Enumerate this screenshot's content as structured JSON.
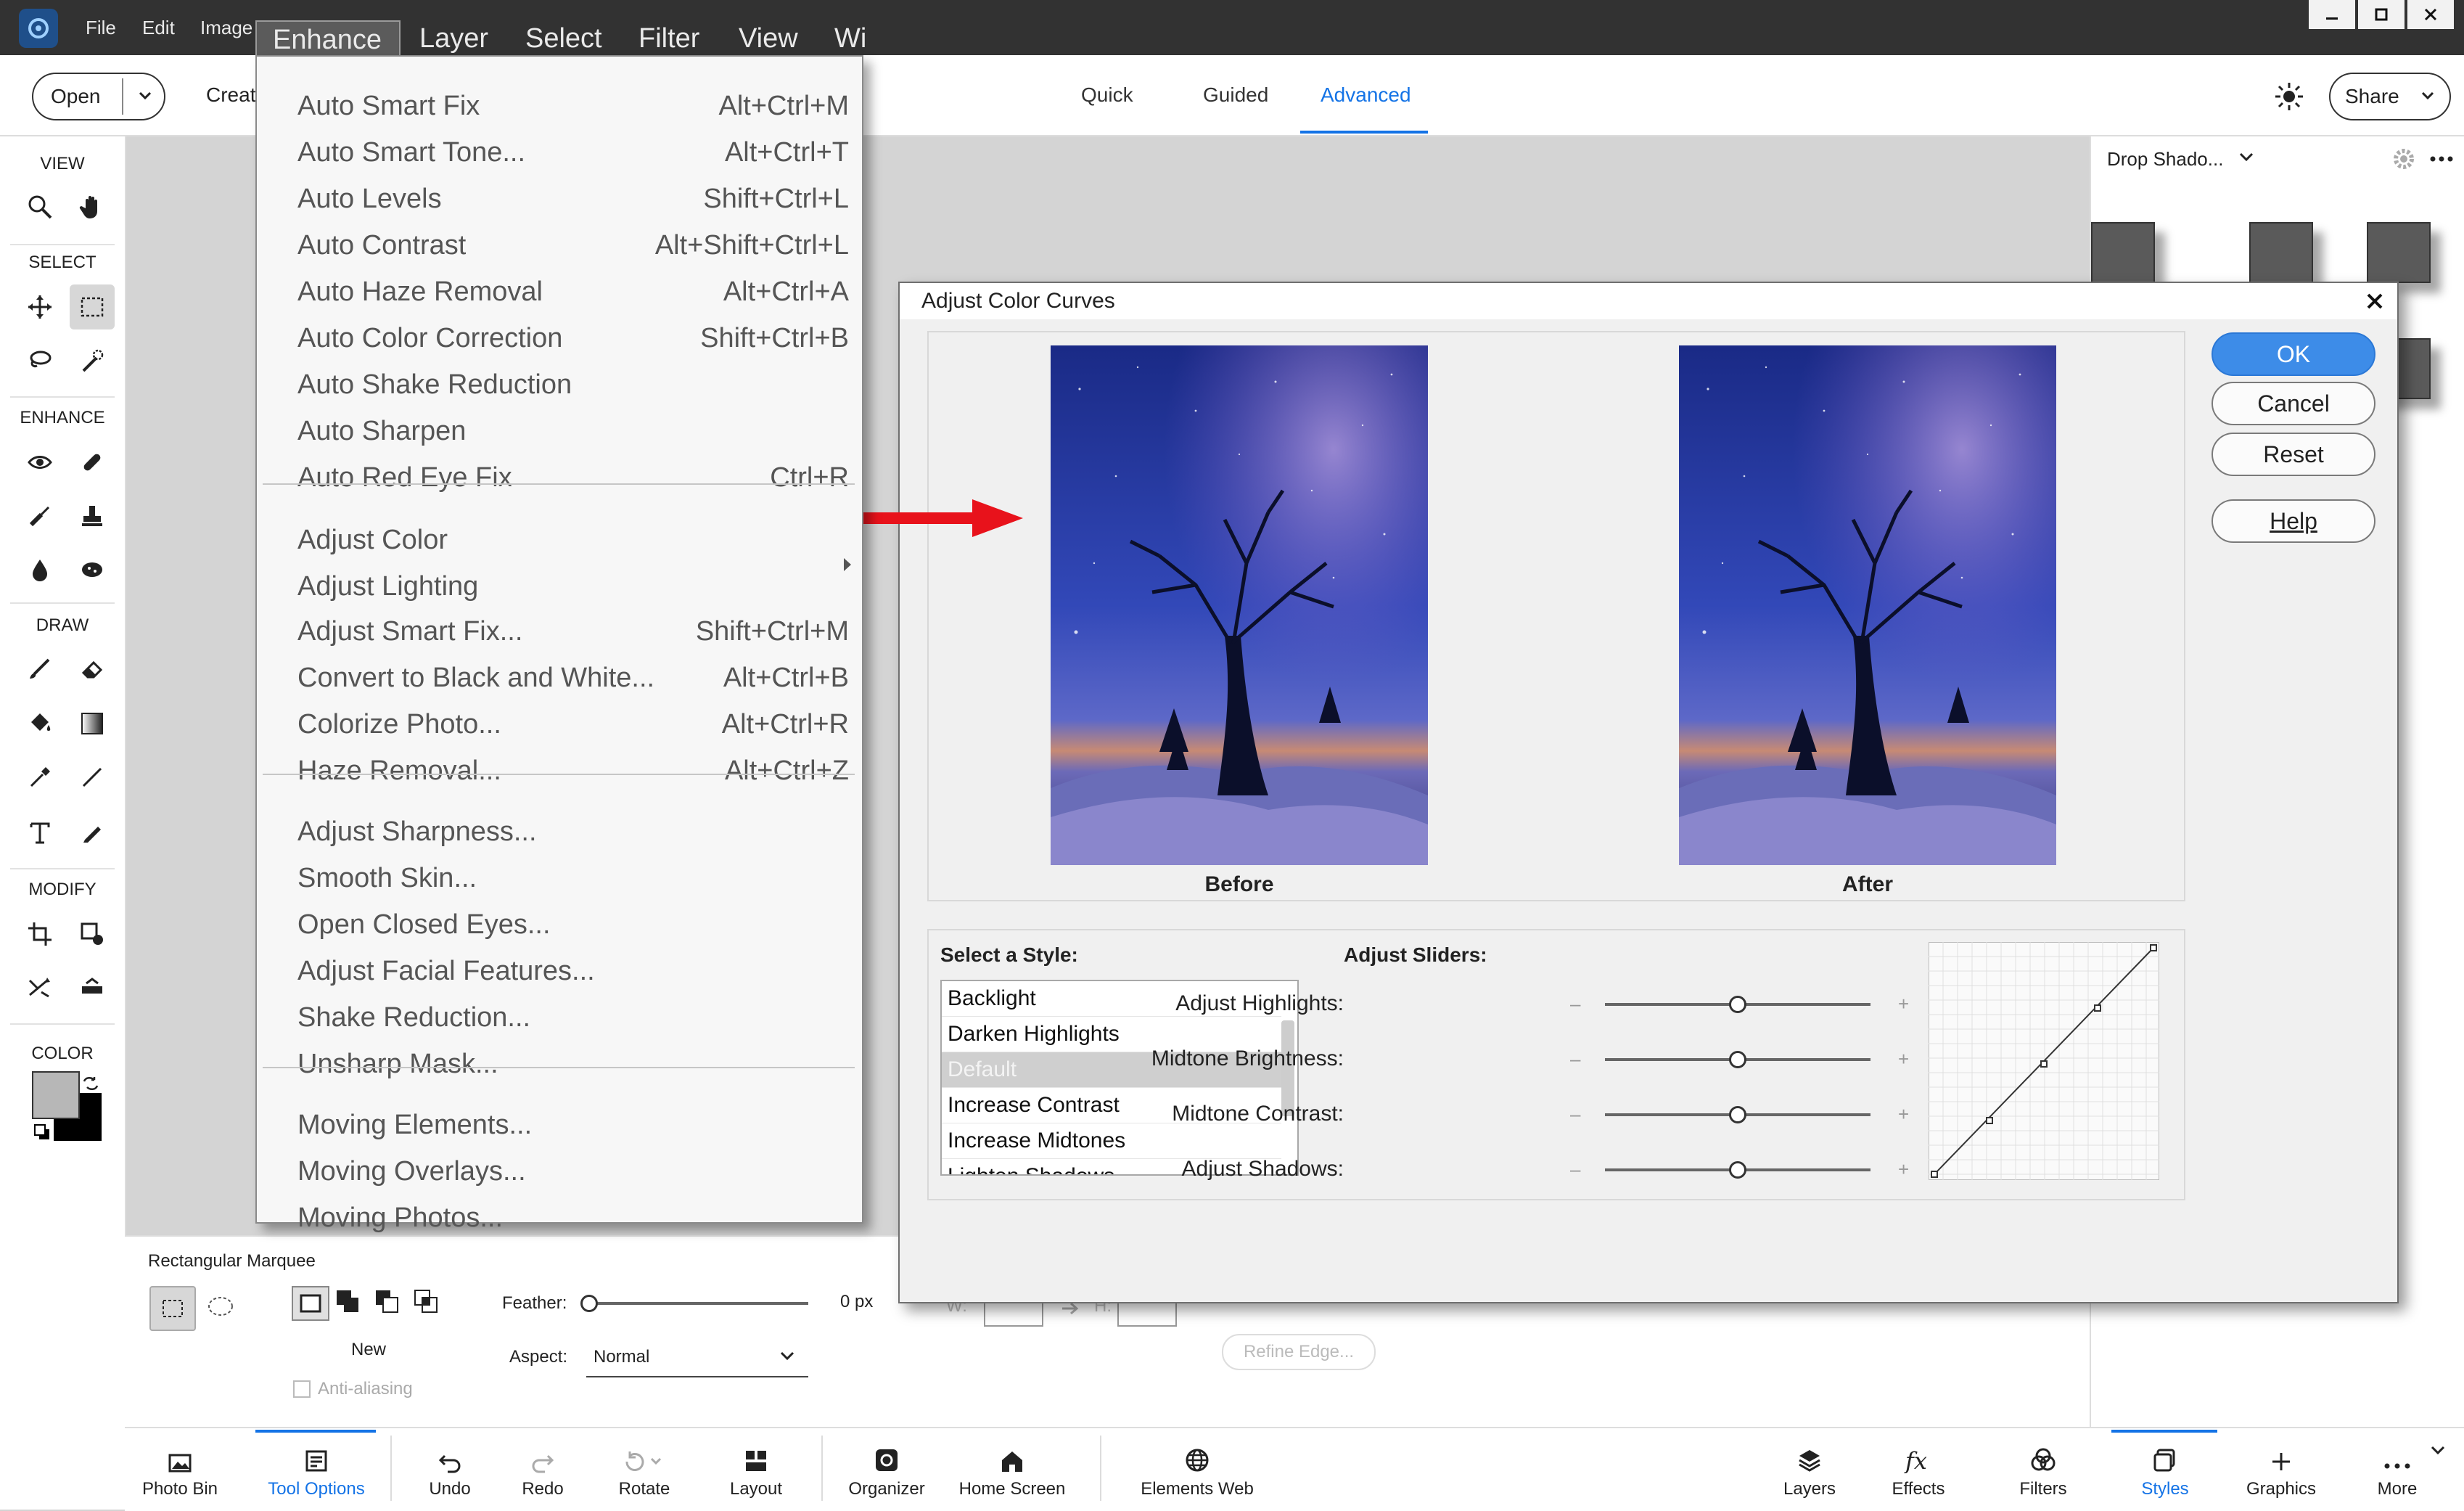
{
  "menubar": {
    "items": [
      "File",
      "Edit",
      "Image",
      "Enhance",
      "Layer",
      "Select",
      "Filter",
      "View",
      "Wi"
    ]
  },
  "window_controls": [
    "minimize",
    "maximize",
    "close"
  ],
  "options_bar": {
    "open_label": "Open",
    "create_label": "Creat",
    "modes": [
      "Quick",
      "Guided",
      "Advanced"
    ],
    "active_mode": "Advanced",
    "share_label": "Share"
  },
  "left_toolbar": {
    "view": "VIEW",
    "select": "SELECT",
    "enhance": "ENHANCE",
    "draw": "DRAW",
    "modify": "MODIFY",
    "color": "COLOR"
  },
  "enhance_menu": {
    "groups": [
      [
        {
          "label": "Auto Smart Fix",
          "shortcut": "Alt+Ctrl+M"
        },
        {
          "label": "Auto Smart Tone...",
          "shortcut": "Alt+Ctrl+T"
        },
        {
          "label": "Auto Levels",
          "shortcut": "Shift+Ctrl+L"
        },
        {
          "label": "Auto Contrast",
          "shortcut": "Alt+Shift+Ctrl+L"
        },
        {
          "label": "Auto Haze Removal",
          "shortcut": "Alt+Ctrl+A"
        },
        {
          "label": "Auto Color Correction",
          "shortcut": "Shift+Ctrl+B"
        },
        {
          "label": "Auto Shake Reduction",
          "shortcut": ""
        },
        {
          "label": "Auto Sharpen",
          "shortcut": ""
        },
        {
          "label": "Auto Red Eye Fix",
          "shortcut": "Ctrl+R"
        }
      ],
      [
        {
          "label": "Adjust Color",
          "shortcut": ""
        },
        {
          "label": "Adjust Lighting",
          "shortcut": ""
        },
        {
          "label": "Adjust Smart Fix...",
          "shortcut": "Shift+Ctrl+M"
        },
        {
          "label": "Convert to Black and White...",
          "shortcut": "Alt+Ctrl+B"
        },
        {
          "label": "Colorize Photo...",
          "shortcut": "Alt+Ctrl+R"
        },
        {
          "label": "Haze Removal...",
          "shortcut": "Alt+Ctrl+Z"
        }
      ],
      [
        {
          "label": "Adjust Sharpness...",
          "shortcut": ""
        },
        {
          "label": "Smooth Skin...",
          "shortcut": ""
        },
        {
          "label": "Open Closed Eyes...",
          "shortcut": ""
        },
        {
          "label": "Adjust Facial Features...",
          "shortcut": ""
        },
        {
          "label": "Shake Reduction...",
          "shortcut": ""
        },
        {
          "label": "Unsharp Mask...",
          "shortcut": ""
        }
      ],
      [
        {
          "label": "Moving Elements...",
          "shortcut": ""
        },
        {
          "label": "Moving Overlays...",
          "shortcut": ""
        },
        {
          "label": "Moving Photos...",
          "shortcut": ""
        }
      ]
    ]
  },
  "dialog": {
    "title": "Adjust Color Curves",
    "before_label": "Before",
    "after_label": "After",
    "buttons": {
      "ok": "OK",
      "cancel": "Cancel",
      "reset": "Reset",
      "help": "Help"
    },
    "style_heading": "Select a Style:",
    "styles": [
      "Backlight",
      "Darken Highlights",
      "Default",
      "Increase Contrast",
      "Increase Midtones",
      "Lighten Shadows"
    ],
    "selected_style": "Default",
    "sliders_heading": "Adjust Sliders:",
    "sliders": [
      {
        "label": "Adjust Highlights:",
        "value": 0.5
      },
      {
        "label": "Midtone Brightness:",
        "value": 0.5
      },
      {
        "label": "Midtone Contrast:",
        "value": 0.5
      },
      {
        "label": "Adjust Shadows:",
        "value": 0.5
      }
    ],
    "minus": "–",
    "plus": "+"
  },
  "right_panel": {
    "dropdown_label": "Drop Shado..."
  },
  "tool_options": {
    "tool_name": "Rectangular Marquee",
    "new_label": "New",
    "anti_alias_label": "Anti-aliasing",
    "feather_label": "Feather:",
    "feather_value": "0 px",
    "aspect_label": "Aspect:",
    "aspect_value": "Normal",
    "width_label": "W:",
    "height_label": "H:",
    "refine_edge_label": "Refine Edge..."
  },
  "bottom_bar": {
    "left": [
      "Photo Bin",
      "Tool Options",
      "Undo",
      "Redo",
      "Rotate",
      "Layout",
      "Organizer",
      "Home Screen",
      "Elements Web"
    ],
    "right": [
      "Layers",
      "Effects",
      "Filters",
      "Styles",
      "Graphics",
      "More"
    ],
    "active_left": "Tool Options",
    "active_right": "Styles"
  },
  "colors": {
    "accent": "#1473e6",
    "arrow": "#e8121b",
    "menubar": "#323232"
  }
}
